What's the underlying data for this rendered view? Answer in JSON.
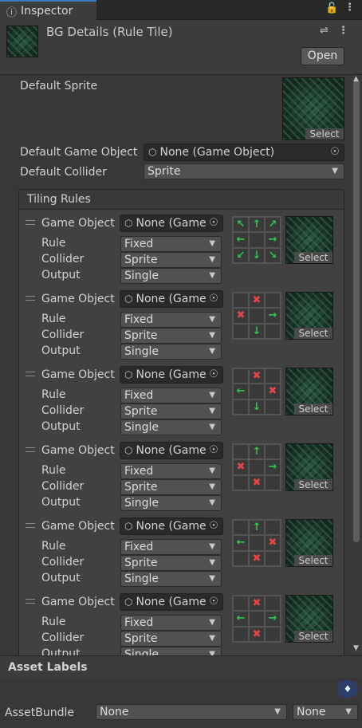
{
  "tab": {
    "icon": "info-icon",
    "label": "Inspector"
  },
  "tab_controls": {
    "lock_icon": "lock-icon",
    "menu_icon": "kebab-menu-icon"
  },
  "header": {
    "title": "BG Details (Rule Tile)",
    "settings_icon": "preset-icon",
    "menu_icon": "kebab-menu-icon",
    "open_label": "Open"
  },
  "default_sprite": {
    "label": "Default Sprite",
    "select_label": "Select"
  },
  "default_game_object": {
    "label": "Default Game Object",
    "value": "None (Game Object)"
  },
  "default_collider": {
    "label": "Default Collider",
    "value": "Sprite"
  },
  "tiling_rules": {
    "title": "Tiling Rules",
    "field_labels": {
      "game_object": "Game Object",
      "rule": "Rule",
      "collider": "Collider",
      "output": "Output"
    },
    "rules": [
      {
        "game_object": "None (Game",
        "rule": "Fixed",
        "collider": "Sprite",
        "output": "Single",
        "select_label": "Select",
        "grid": [
          "arrow-up-left",
          "arrow-up",
          "arrow-up-right",
          "arrow-left",
          "",
          "arrow-right",
          "arrow-down-left",
          "arrow-down",
          "arrow-down-right"
        ]
      },
      {
        "game_object": "None (Game",
        "rule": "Fixed",
        "collider": "Sprite",
        "output": "Single",
        "select_label": "Select",
        "grid": [
          "",
          "x",
          "",
          "x",
          "",
          "arrow-right",
          "",
          "arrow-down",
          ""
        ]
      },
      {
        "game_object": "None (Game",
        "rule": "Fixed",
        "collider": "Sprite",
        "output": "Single",
        "select_label": "Select",
        "grid": [
          "",
          "x",
          "",
          "arrow-left",
          "",
          "x",
          "",
          "arrow-down",
          ""
        ]
      },
      {
        "game_object": "None (Game",
        "rule": "Fixed",
        "collider": "Sprite",
        "output": "Single",
        "select_label": "Select",
        "grid": [
          "",
          "arrow-up",
          "",
          "x",
          "",
          "arrow-right",
          "",
          "x",
          ""
        ]
      },
      {
        "game_object": "None (Game",
        "rule": "Fixed",
        "collider": "Sprite",
        "output": "Single",
        "select_label": "Select",
        "grid": [
          "",
          "arrow-up",
          "",
          "arrow-left",
          "",
          "x",
          "",
          "x",
          ""
        ]
      },
      {
        "game_object": "None (Game",
        "rule": "Fixed",
        "collider": "Sprite",
        "output": "Single",
        "select_label": "Select",
        "grid": [
          "",
          "x",
          "",
          "arrow-left",
          "",
          "arrow-right",
          "",
          "x",
          ""
        ]
      }
    ]
  },
  "asset_labels": {
    "title": "Asset Labels",
    "tag_icon": "tag-icon"
  },
  "asset_bundle": {
    "label": "AssetBundle",
    "name_value": "None",
    "variant_value": "None"
  },
  "colors": {
    "accent": "#3a79bb",
    "green_arrow": "#2ec84a",
    "red_x": "#e04848",
    "tile_green": "#1f3a2c"
  }
}
